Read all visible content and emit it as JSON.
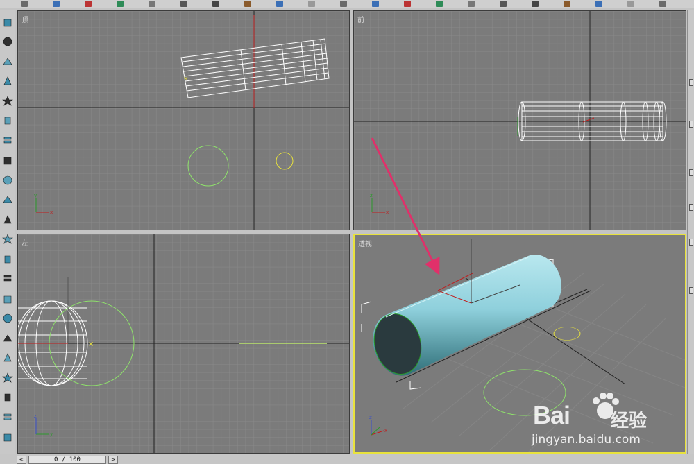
{
  "viewports": {
    "top": {
      "label": "顶"
    },
    "front": {
      "label": "前"
    },
    "left": {
      "label": "左"
    },
    "perspective": {
      "label": "透视"
    }
  },
  "axes": {
    "x": "x",
    "y": "y",
    "z": "z"
  },
  "time_slider": {
    "prev": "<",
    "frame": "0 / 100",
    "next": ">"
  },
  "watermark": {
    "brand": "Bai",
    "site_cn": "经验",
    "url": "jingyan.baidu.com"
  },
  "colors": {
    "viewport_bg": "#7b7b7b",
    "grid": "#8a8a8a",
    "active_border": "#e8e23c",
    "wireframe": "#ffffff",
    "circle": "#8fe36b",
    "cylinder": "#8fd0dc",
    "annotation_arrow": "#e0306a"
  },
  "toolbar_icons": [
    "select-icon",
    "move-icon",
    "rotate-icon",
    "scale-icon",
    "undo-icon",
    "redo-icon",
    "link-icon",
    "unlink-icon",
    "bind-icon",
    "filter-icon",
    "snap-icon",
    "angle-snap-icon",
    "mirror-icon",
    "align-icon",
    "layer-icon",
    "curve-icon",
    "schematic-icon",
    "material-icon",
    "render-icon",
    "quick-render-icon",
    "spell-icon"
  ],
  "left_icons": [
    "box-icon",
    "sphere-icon",
    "teapot-icon",
    "cone-icon",
    "star-icon",
    "light-icon",
    "layers-icon",
    "wrench-icon",
    "hammer-icon",
    "gear-icon",
    "tools-icon",
    "display-icon",
    "wave-icon",
    "spiral-icon",
    "utility-icon",
    "bone-icon",
    "bend-icon",
    "particle-icon",
    "camera-icon",
    "helper-icon",
    "space-warp-icon",
    "system-icon"
  ]
}
